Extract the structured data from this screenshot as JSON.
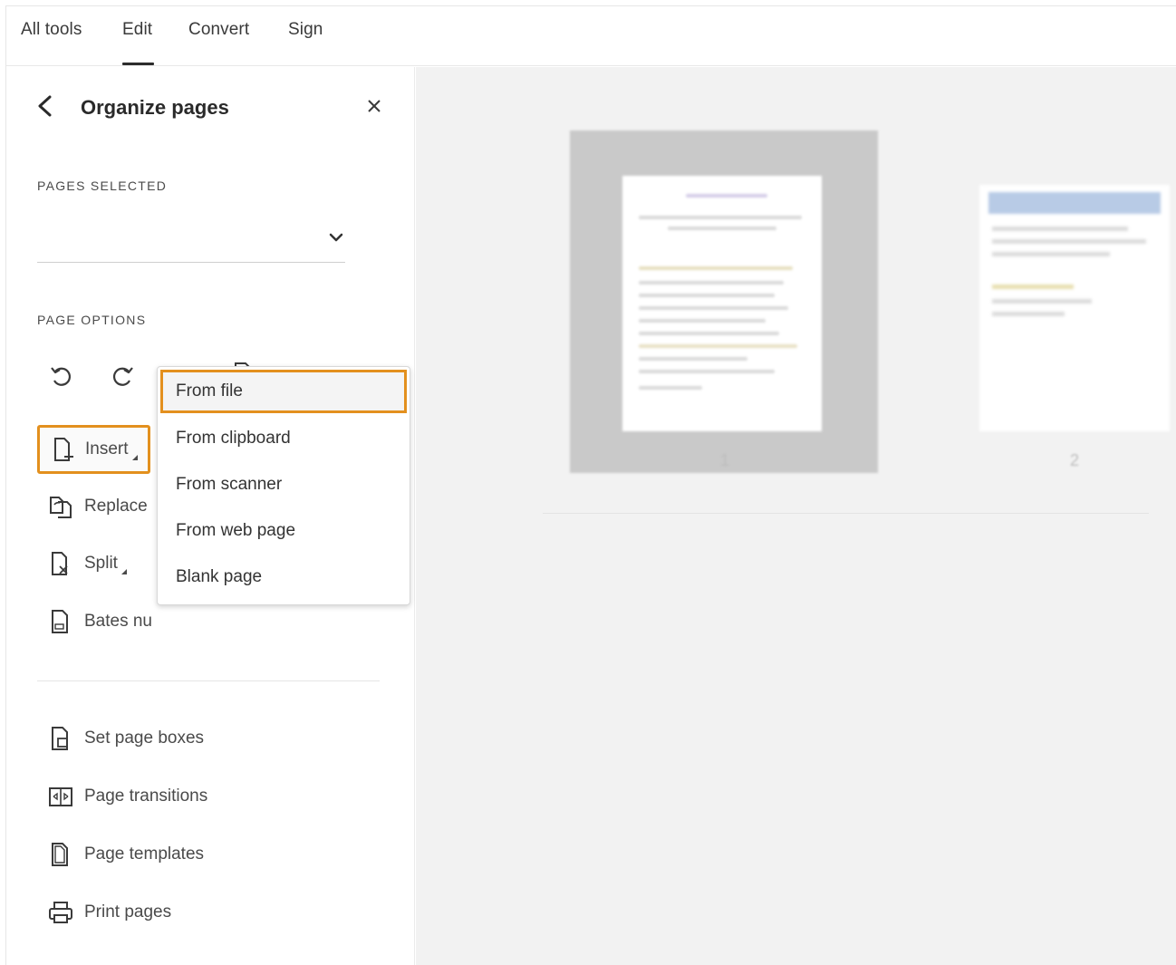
{
  "nav": {
    "tabs": [
      {
        "label": "All tools"
      },
      {
        "label": "Edit"
      },
      {
        "label": "Convert"
      },
      {
        "label": "Sign"
      }
    ],
    "active_tab": "Edit"
  },
  "panel": {
    "title": "Organize pages",
    "pages_selected_label": "PAGES SELECTED",
    "pages_selected_value": "",
    "page_options_label": "PAGE OPTIONS",
    "option_icons": [
      "rotate-left-icon",
      "rotate-right-icon",
      "trash-icon",
      "extract-page-icon"
    ],
    "tools": [
      {
        "label": "Insert",
        "icon": "insert-page-icon"
      },
      {
        "label": "Replace",
        "icon": "replace-page-icon"
      },
      {
        "label": "Split",
        "icon": "split-page-icon"
      },
      {
        "label": "Bates nu",
        "icon": "bates-numbering-icon"
      }
    ],
    "more_tools": [
      {
        "label": "Set page boxes",
        "icon": "page-boxes-icon"
      },
      {
        "label": "Page transitions",
        "icon": "page-transitions-icon"
      },
      {
        "label": "Page templates",
        "icon": "page-templates-icon"
      },
      {
        "label": "Print pages",
        "icon": "printer-icon"
      }
    ]
  },
  "insert_menu": {
    "items": [
      {
        "label": "From file",
        "selected": true
      },
      {
        "label": "From clipboard"
      },
      {
        "label": "From scanner"
      },
      {
        "label": "From web page"
      },
      {
        "label": "Blank page"
      }
    ]
  },
  "thumbnails": [
    {
      "page": "1"
    },
    {
      "page": "2"
    }
  ],
  "colors": {
    "highlight": "#e3901e",
    "content_bg": "#f2f2f2"
  }
}
